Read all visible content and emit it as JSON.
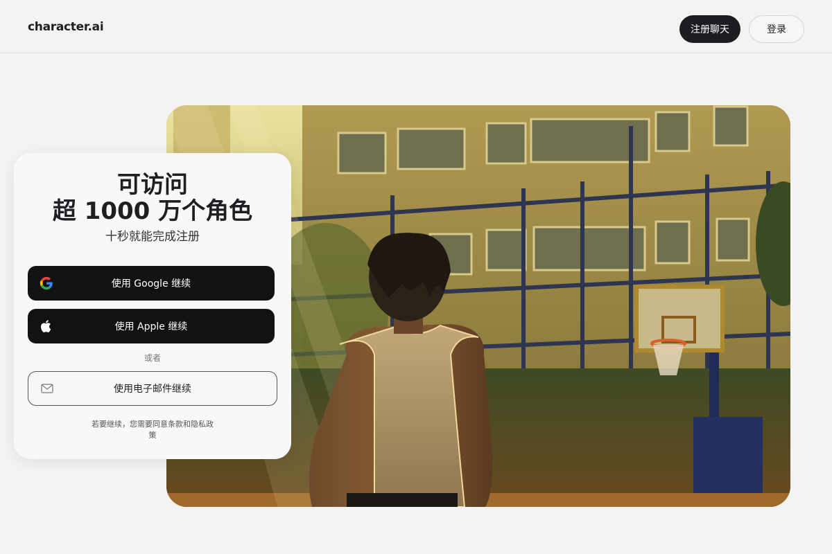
{
  "header": {
    "logo": "character.ai",
    "signup_label": "注册聊天",
    "login_label": "登录"
  },
  "card": {
    "title_line1": "可访问",
    "title_line2": "超 1000 万个角色",
    "subtitle": "十秒就能完成注册",
    "google_label": "使用 Google 继续",
    "apple_label": "使用 Apple 继续",
    "or_label": "或者",
    "email_label": "使用电子邮件继续",
    "terms": "若要继续，您需要同意条款和隐私政策"
  },
  "hero": {
    "description_icon": "basketball-court-illustration"
  },
  "colors": {
    "background": "#f3f3f3",
    "primary_button": "#1c1c21",
    "card": "#f8f8f8"
  }
}
